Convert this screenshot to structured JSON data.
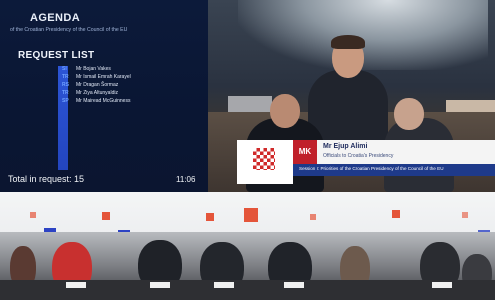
{
  "agenda": {
    "title": "AGENDA",
    "subtitle": "of the Croatian Presidency of the Council of the EU"
  },
  "request_list": {
    "title": "REQUEST LIST",
    "entries": [
      {
        "code": "SI",
        "name": "Mr Bojan Vakes"
      },
      {
        "code": "TR",
        "name": "Mr Ismail Emrah Karayel"
      },
      {
        "code": "RS",
        "name": "Mr Dragan Šormaz"
      },
      {
        "code": "TR",
        "name": "Mr Ziya Altunyaldiz"
      },
      {
        "code": "SP",
        "name": "Mr Mairead McGuinness"
      }
    ],
    "total_label": "Total in request: 15",
    "clock": "11:06"
  },
  "caption": {
    "country_code": "MK",
    "speaker_name": "Mr Ejup Alimi",
    "speaker_role": "Officials to Croatia's Presidency",
    "session": "Session I: Priorities of the Croatian Presidency of the Council of the EU"
  },
  "colors": {
    "agenda_bg": "#0c1a3a",
    "request_bar": "#2c55d6",
    "caption_red": "#c0202a",
    "caption_blue": "#1e3a8a",
    "led_red": "#e4553a",
    "led_blue": "#2d43c4"
  }
}
